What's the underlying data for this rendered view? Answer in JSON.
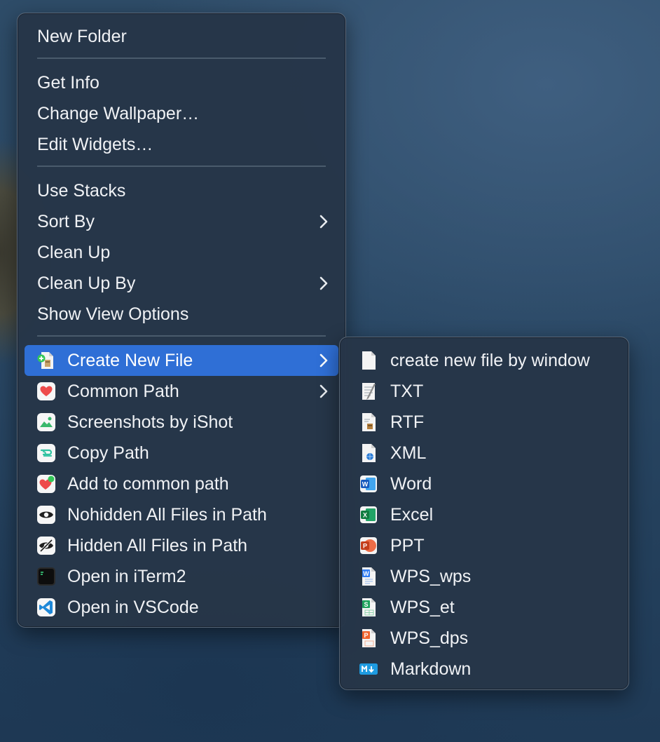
{
  "main_menu": {
    "items": [
      {
        "label": "New Folder"
      },
      {
        "label": "Get Info"
      },
      {
        "label": "Change Wallpaper…"
      },
      {
        "label": "Edit Widgets…"
      },
      {
        "label": "Use Stacks"
      },
      {
        "label": "Sort By"
      },
      {
        "label": "Clean Up"
      },
      {
        "label": "Clean Up By"
      },
      {
        "label": "Show View Options"
      },
      {
        "label": "Create New File",
        "icon": "create-file-icon"
      },
      {
        "label": "Common Path",
        "icon": "heart-icon"
      },
      {
        "label": "Screenshots by iShot",
        "icon": "ishot-icon"
      },
      {
        "label": "Copy Path",
        "icon": "copy-path-icon"
      },
      {
        "label": "Add to common path",
        "icon": "heart-plus-icon"
      },
      {
        "label": "Nohidden All Files in Path",
        "icon": "eye-icon"
      },
      {
        "label": "Hidden All Files in Path",
        "icon": "eye-slash-icon"
      },
      {
        "label": "Open in iTerm2",
        "icon": "iterm2-icon"
      },
      {
        "label": "Open in VSCode",
        "icon": "vscode-icon"
      }
    ]
  },
  "sub_menu": {
    "items": [
      {
        "label": "create new file by window",
        "icon": "blank-file-icon"
      },
      {
        "label": "TXT",
        "icon": "txt-file-icon"
      },
      {
        "label": "RTF",
        "icon": "rtf-file-icon"
      },
      {
        "label": "XML",
        "icon": "xml-file-icon"
      },
      {
        "label": "Word",
        "icon": "word-icon"
      },
      {
        "label": "Excel",
        "icon": "excel-icon"
      },
      {
        "label": "PPT",
        "icon": "powerpoint-icon"
      },
      {
        "label": "WPS_wps",
        "icon": "wps-writer-icon"
      },
      {
        "label": "WPS_et",
        "icon": "wps-spreadsheet-icon"
      },
      {
        "label": "WPS_dps",
        "icon": "wps-presentation-icon"
      },
      {
        "label": "Markdown",
        "icon": "markdown-icon"
      }
    ]
  },
  "colors": {
    "menu_background": "#263648",
    "highlight": "#2f6fd6",
    "text": "#f0f2f5",
    "separator": "#aab9c8"
  }
}
